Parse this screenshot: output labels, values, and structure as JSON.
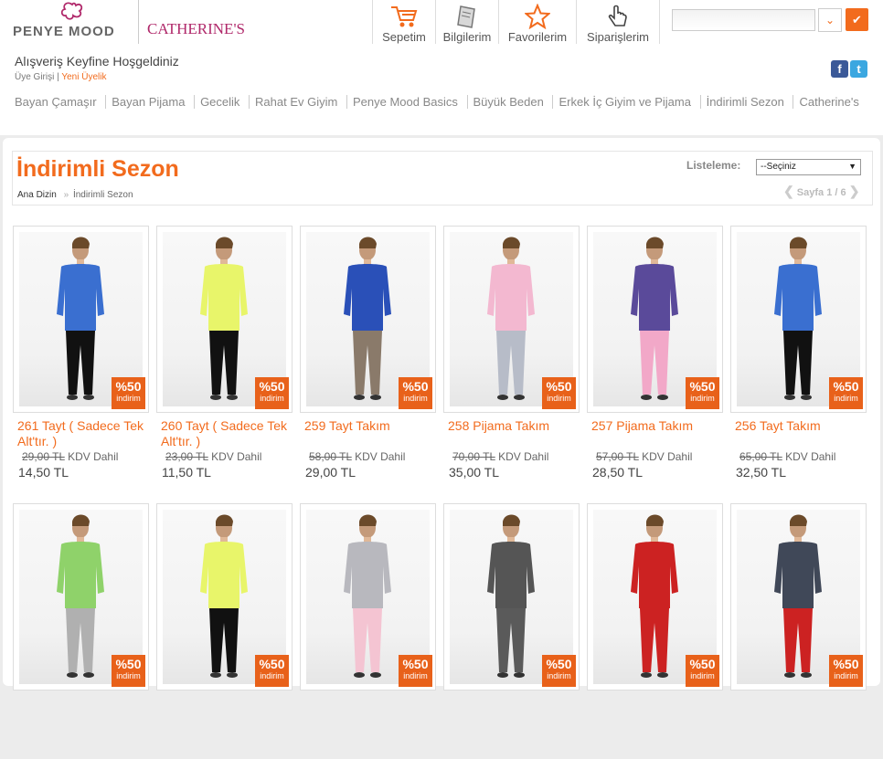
{
  "brand": {
    "logo_text": "PENYE MOOD",
    "second_brand": "CATHERINE'S",
    "flower_color": "#b0286a"
  },
  "nav": [
    {
      "label": "Sepetim",
      "icon": "cart-icon"
    },
    {
      "label": "Bilgilerim",
      "icon": "notebook-icon"
    },
    {
      "label": "Favorilerim",
      "icon": "star-icon"
    },
    {
      "label": "Siparişlerim",
      "icon": "hand-pointer-icon"
    }
  ],
  "search": {
    "placeholder": ""
  },
  "welcome": {
    "text": "Alışveriş Keyfine Hoşgeldiniz",
    "login": "Üye Girişi",
    "divider": "|",
    "register": "Yeni Üyelik"
  },
  "categories": [
    "Bayan Çamaşır",
    "Bayan Pijama",
    "Gecelik",
    "Rahat Ev Giyim",
    "Penye Mood Basics",
    "Büyük Beden",
    "Erkek İç Giyim ve Pijama",
    "İndirimli Sezon",
    "Catherine's"
  ],
  "page": {
    "title": "İndirimli Sezon",
    "breadcrumb": {
      "home": "Ana Dizin",
      "sep": "»",
      "current": "İndirimli Sezon"
    },
    "sort_label": "Listeleme:",
    "sort_value": "--Seçiniz",
    "pager": "Sayfa 1 / 6"
  },
  "accent_color": "#f26b1d",
  "products": [
    {
      "name": "261 Tayt ( Sadece Tek Alt'tır. )",
      "old_price": "29,00 TL",
      "vat": "KDV Dahil",
      "price": "14,50 TL",
      "badge": "%50",
      "badge_sub": "indirim",
      "top": "#3a6fd0",
      "bottom": "#111111"
    },
    {
      "name": "260 Tayt ( Sadece Tek Alt'tır. )",
      "old_price": "23,00 TL",
      "vat": "KDV Dahil",
      "price": "11,50 TL",
      "badge": "%50",
      "badge_sub": "indirim",
      "top": "#e8f56a",
      "bottom": "#111111"
    },
    {
      "name": "259 Tayt Takım",
      "old_price": "58,00 TL",
      "vat": "KDV Dahil",
      "price": "29,00 TL",
      "badge": "%50",
      "badge_sub": "indirim",
      "top": "#2a50b8",
      "bottom": "#8a7a6a"
    },
    {
      "name": "258 Pijama Takım",
      "old_price": "70,00 TL",
      "vat": "KDV Dahil",
      "price": "35,00 TL",
      "badge": "%50",
      "badge_sub": "indirim",
      "top": "#f3b8d0",
      "bottom": "#b7bcc8"
    },
    {
      "name": "257 Pijama Takım",
      "old_price": "57,00 TL",
      "vat": "KDV Dahil",
      "price": "28,50 TL",
      "badge": "%50",
      "badge_sub": "indirim",
      "top": "#5a4a9a",
      "bottom": "#f2a8c8"
    },
    {
      "name": "256 Tayt Takım",
      "old_price": "65,00 TL",
      "vat": "KDV Dahil",
      "price": "32,50 TL",
      "badge": "%50",
      "badge_sub": "indirim",
      "top": "#3a6fd0",
      "bottom": "#111111"
    },
    {
      "badge": "%50",
      "badge_sub": "indirim",
      "top": "#8fd26a",
      "bottom": "#b0b0b0"
    },
    {
      "badge": "%50",
      "badge_sub": "indirim",
      "top": "#e8f56a",
      "bottom": "#111111"
    },
    {
      "badge": "%50",
      "badge_sub": "indirim",
      "top": "#b8b8be",
      "bottom": "#f4c4d2"
    },
    {
      "badge": "%50",
      "badge_sub": "indirim",
      "top": "#555555",
      "bottom": "#5a5a5a"
    },
    {
      "badge": "%50",
      "badge_sub": "indirim",
      "top": "#cc2222",
      "bottom": "#cc2222"
    },
    {
      "badge": "%50",
      "badge_sub": "indirim",
      "top": "#404858",
      "bottom": "#cc2222"
    }
  ]
}
